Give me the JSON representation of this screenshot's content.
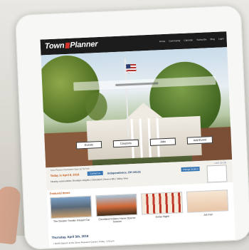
{
  "app": {
    "logo_text_1": "Town",
    "logo_text_2": "Planner",
    "nav": [
      "Home",
      "Community",
      "Calendar",
      "Subscribe",
      "Blog",
      "Login"
    ]
  },
  "hero": {
    "buttons": [
      "Events",
      "Coupons",
      "Jobs",
      "Add Event"
    ]
  },
  "info": {
    "small_note": "Town Planner Newsletter Sign Up for free",
    "today_label": "Today is April 8, 2018",
    "pill_left": "Contact us",
    "independence_label": "Independence, OH 44131",
    "pill_right": "Change location",
    "nearby": "Nearby communities: Brooklyn Heights | Cleveland | Seven Hills | Valley View",
    "ad_label": "LIKE US ON"
  },
  "featured": {
    "title": "Featured Items",
    "cards": [
      {
        "title": "The Greater Smoke-Infused Car"
      },
      {
        "title": "Cleveland Indians Home Opener Season"
      },
      {
        "title": "Dollar Night!"
      },
      {
        "title": "Job Fair"
      }
    ]
  },
  "events": {
    "date": "Thursday, April 5th, 2018",
    "first": "• NASA Speech at the Glenn Research Center | Today - 2:00 pm"
  },
  "colors": {
    "accent": "#c45a1a",
    "brand_bar": "#1c1c1c",
    "link_blue": "#3a78b5"
  }
}
